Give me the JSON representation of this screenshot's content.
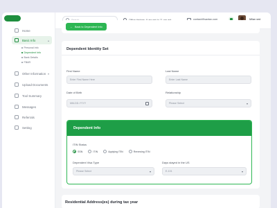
{
  "sidebar": {
    "items": [
      {
        "label": "Home",
        "icon": "home-icon"
      },
      {
        "label": "Basic Info",
        "icon": "user-icon"
      },
      {
        "label": "Other Information",
        "icon": "info-icon"
      },
      {
        "label": "Upload Documents",
        "icon": "upload-icon"
      },
      {
        "label": "Tool Summary",
        "icon": "summary-icon"
      },
      {
        "label": "Messages",
        "icon": "message-icon"
      },
      {
        "label": "Referrals",
        "icon": "referral-icon"
      },
      {
        "label": "Setting",
        "icon": "gear-icon"
      }
    ],
    "sub_items": [
      {
        "label": "Personal Info"
      },
      {
        "label": "Dependent Info"
      },
      {
        "label": "Bank Details"
      },
      {
        "label": "FBAR"
      }
    ]
  },
  "topbar": {
    "search_placeholder": "Search...",
    "office_hours": "Office timings: 9 am est to 11 pm est",
    "email": "contact@saxtax.com",
    "user_name": "Milan yed"
  },
  "back_button": "Back to Dependent Info",
  "identity": {
    "title": "Dependent Identity Set",
    "first_name_label": "First Name",
    "first_name_placeholder": "Enter First Name Here",
    "last_name_label": "Last Name",
    "last_name_placeholder": "Enter Last Name",
    "dob_label": "Date of Birth",
    "dob_placeholder": "MM-DD-YYYY",
    "relationship_label": "Relationship",
    "relationship_value": "Please Select"
  },
  "dependent_info": {
    "title": "Dependent Info",
    "itin_label": "ITIN Status",
    "radios": [
      {
        "label": "SSN",
        "selected": true
      },
      {
        "label": "ITIN",
        "selected": false
      },
      {
        "label": "Applying ITIN",
        "selected": false
      },
      {
        "label": "Renewing ITIN",
        "selected": false
      }
    ],
    "visa_label": "Dependent Visa Type",
    "visa_value": "Please Select",
    "days_label": "Days stayed in the US",
    "days_value": "E-101"
  },
  "residential": {
    "title": "Residential Address(es) during tax year"
  },
  "colors": {
    "accent": "#1e8e3e",
    "button": "#2db653",
    "background": "#e6e7f2"
  }
}
